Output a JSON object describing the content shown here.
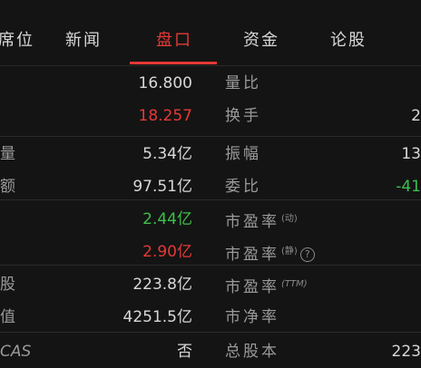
{
  "tabs": [
    {
      "label": "席位"
    },
    {
      "label": "新闻"
    },
    {
      "label": "盘口"
    },
    {
      "label": "资金"
    },
    {
      "label": "论股"
    }
  ],
  "colors": {
    "up": "#e53935",
    "down": "#3cc04a",
    "accent": "#e53935"
  },
  "rows": [
    {
      "left_label": "",
      "left_value": "16.800",
      "right_label": "量比",
      "right_value": ""
    },
    {
      "left_label": "",
      "left_value": "18.257",
      "right_label": "换手",
      "right_value": "2"
    },
    {
      "left_label": "量",
      "left_value": "5.34亿",
      "right_label": "振幅",
      "right_value": "13"
    },
    {
      "left_label": "额",
      "left_value": "97.51亿",
      "right_label": "委比",
      "right_value": "-41"
    },
    {
      "left_label": "",
      "left_value": "2.44亿",
      "right_label": "市盈率",
      "right_label_sup": "(动)",
      "right_value": ""
    },
    {
      "left_label": "",
      "left_value": "2.90亿",
      "right_label": "市盈率",
      "right_label_sup": "(静)",
      "right_value": ""
    },
    {
      "left_label": "股",
      "left_value": "223.8亿",
      "right_label": "市盈率",
      "right_label_sup": "(TTM)",
      "right_value": ""
    },
    {
      "left_label": "值",
      "left_value": "4251.5亿",
      "right_label": "市净率",
      "right_value": ""
    },
    {
      "left_label": "CAS",
      "left_value": "否",
      "right_label": "总股本",
      "right_value": "223"
    }
  ],
  "help_glyph": "?"
}
